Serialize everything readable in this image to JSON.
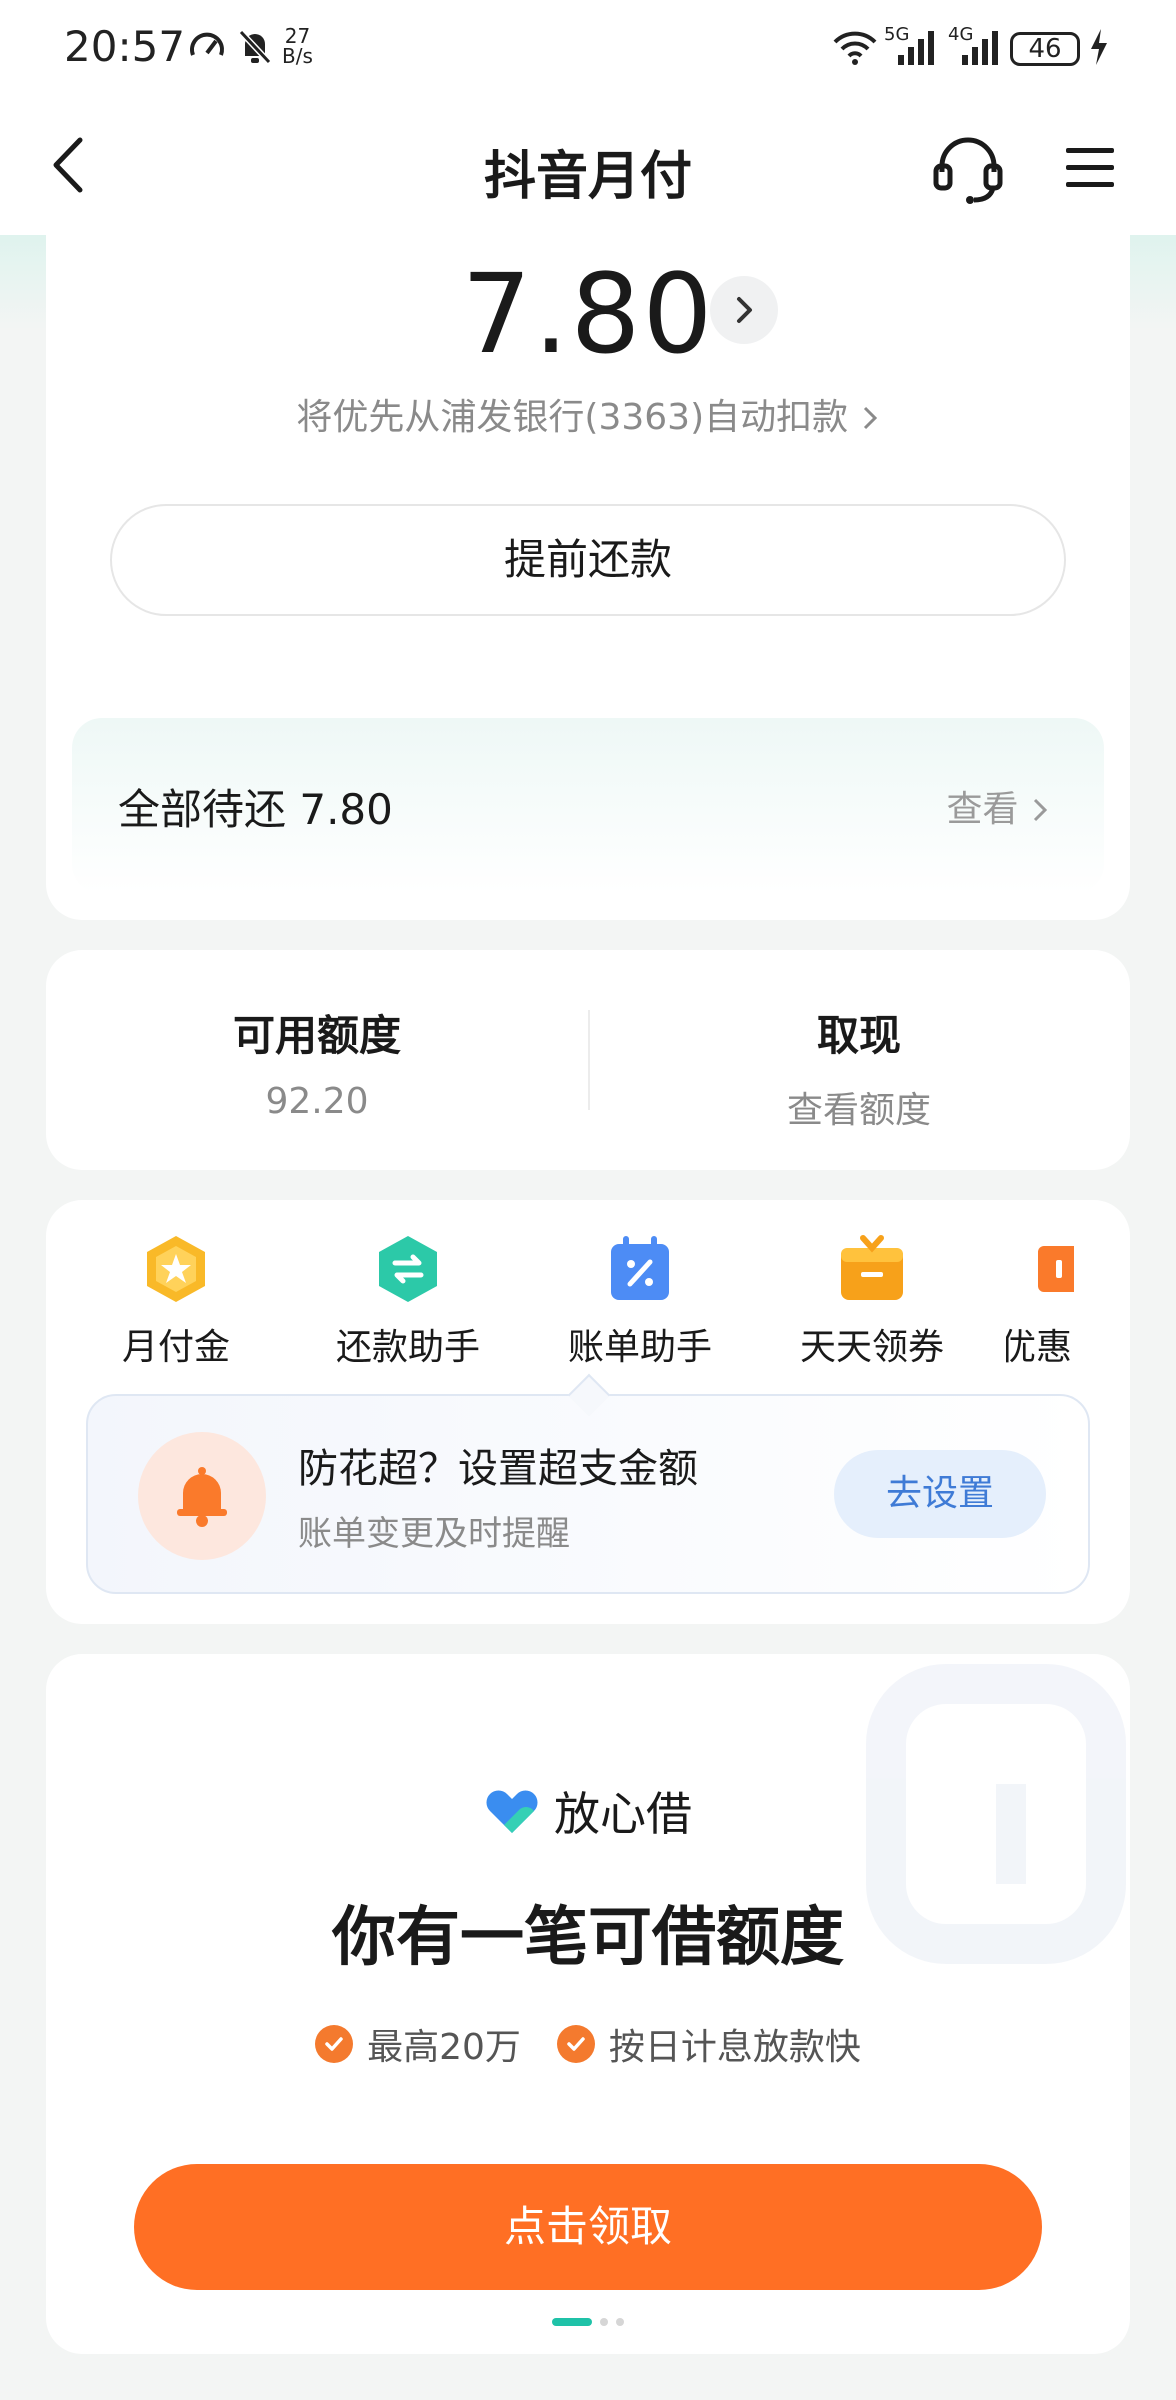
{
  "status_bar": {
    "time": "20:57",
    "speed_value": "27",
    "speed_unit": "B/s",
    "net1": "5G",
    "net2": "4G",
    "battery": "46"
  },
  "nav": {
    "title": "抖音月付",
    "icons": [
      "back-icon",
      "headset-icon",
      "menu-icon"
    ]
  },
  "bill": {
    "amount": "7.80",
    "autopay_text": "将优先从浦发银行(3363)自动扣款",
    "repay_button": "提前还款",
    "pending_label": "全部待还 7.80",
    "pending_view": "查看"
  },
  "credit": {
    "available_title": "可用额度",
    "available_value": "92.20",
    "withdraw_title": "取现",
    "withdraw_sub": "查看额度"
  },
  "tools": [
    {
      "label": "月付金",
      "icon": "star-hexagon-icon",
      "color": "#f9b928"
    },
    {
      "label": "还款助手",
      "icon": "swap-hexagon-icon",
      "color": "#2cc9a8"
    },
    {
      "label": "账单助手",
      "icon": "percent-calendar-icon",
      "color": "#4d8cf5"
    },
    {
      "label": "天天领券",
      "icon": "gift-icon",
      "color": "#f7a11a"
    },
    {
      "label": "优惠",
      "icon": "coupon-icon",
      "color": "#fa7a2b"
    }
  ],
  "reminder": {
    "title": "防花超？设置超支金额",
    "subtitle": "账单变更及时提醒",
    "button": "去设置"
  },
  "loan": {
    "brand": "放心借",
    "title": "你有一笔可借额度",
    "benefits": [
      "最高20万",
      "按日计息放款快"
    ],
    "button": "点击领取"
  },
  "colors": {
    "accent_orange": "#ff6f24",
    "accent_teal": "#1fc2a8",
    "link_blue": "#3f7bd6"
  }
}
